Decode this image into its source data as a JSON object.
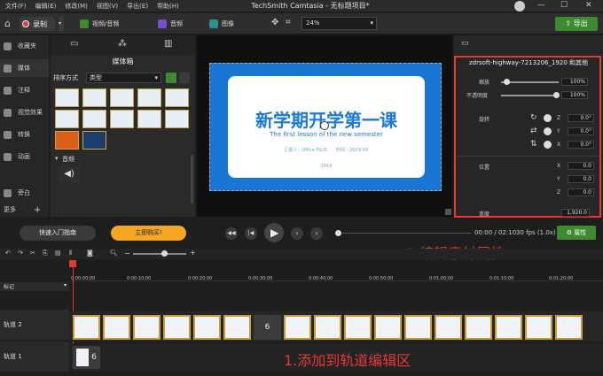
{
  "menu": [
    "文件(F)",
    "编辑(E)",
    "修改(M)",
    "视图(V)",
    "导出(E)",
    "帮助(H)"
  ],
  "window_title": "TechSmith Camtasia - 无标题项目*",
  "toolbar": {
    "record": "录制",
    "video_audio": "视频/音频",
    "audio": "音频",
    "image": "图像",
    "zoom": "24%",
    "export": "导出"
  },
  "sidebar": {
    "items": [
      "收藏夹",
      "媒体",
      "注释",
      "视觉效果",
      "转换",
      "动画",
      "旁白"
    ],
    "more": "更多"
  },
  "media": {
    "title": "媒体箱",
    "sort_label": "排序方式",
    "sort_value": "类型",
    "audio_section": "音频"
  },
  "slide": {
    "title": "新学期开学第一课",
    "subtitle": "The first lesson of the new semester",
    "tags": "汇报人：Office PLUS　　时间：20XX.XX",
    "footer": "20XX"
  },
  "properties": {
    "header": "zdrsoft-highway-7213206_1920 和其他",
    "scale_label": "缩放",
    "scale_value": "100%",
    "opacity_label": "不透明度",
    "opacity_value": "100%",
    "rotation_label": "旋转",
    "rotation": [
      {
        "axis": "Z",
        "value": "0.0°"
      },
      {
        "axis": "Y",
        "value": "0.0°"
      },
      {
        "axis": "X",
        "value": "0.0°"
      }
    ],
    "position_label": "位置",
    "position": [
      {
        "axis": "X",
        "value": "0.0"
      },
      {
        "axis": "Y",
        "value": "0.0"
      },
      {
        "axis": "Z",
        "value": "0.0"
      }
    ],
    "width_label": "宽度",
    "width_value": "1,920.0"
  },
  "controls": {
    "guide": "快速入门指南",
    "buy": "立即购买!",
    "time": "00:00 / 02:10",
    "fps": "30 fps (1.0x)",
    "properties": "属性"
  },
  "annotations": {
    "edit_props": "2.编辑素材属性",
    "add_track": "1.添加到轨道编辑区"
  },
  "timeline": {
    "ticks": [
      "0:00:00;00",
      "0:00:10;00",
      "0:00:20;00",
      "0:00:30;00",
      "0:00:40;00",
      "0:00:50;00",
      "0:01:00;00",
      "0:01:10;00",
      "0:01:20;00"
    ],
    "marker_label": "标记",
    "track2": "轨道 2",
    "track1": "轨道 1",
    "group_count": "6"
  },
  "colors": {
    "accent_green": "#3d8a2f",
    "record_red": "#e53935",
    "annotation_red": "#e53935",
    "buy_orange": "#f5a623"
  }
}
